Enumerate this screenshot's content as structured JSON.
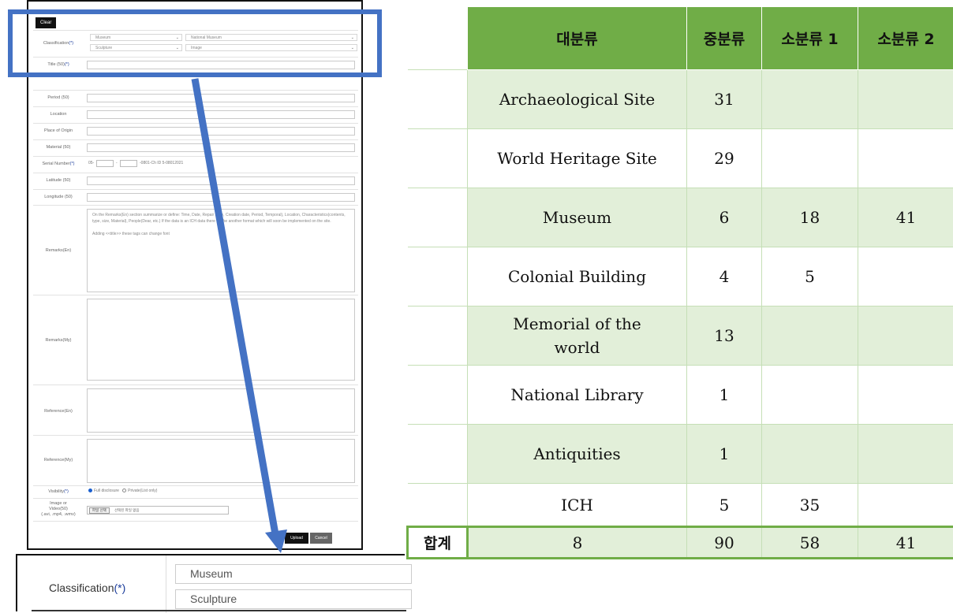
{
  "form": {
    "top_button": "Clear",
    "classification": {
      "label": "Classification",
      "required_mark": "(*)",
      "select1": "Museum",
      "select2": "National Museum",
      "select3": "Sculpture",
      "select4": "Image"
    },
    "title_label": "Title (50)",
    "title_req": "(*)",
    "period_label": "Period (50)",
    "location_label": "Location",
    "place_label": "Place of Origin",
    "material_label": "Material (50)",
    "serial_label": "Serial Number",
    "serial_req": "(*)",
    "serial_prefix": "05-",
    "serial_sep": "-",
    "serial_suffix": "-0801-Ch ID 5-08012021",
    "latitude_label": "Latitude (50)",
    "longitude_label": "Longitude (50)",
    "remarks_en_label": "Remarks(En)",
    "remarks_en_text": "On the Remarks(En) section summarize or define: Time, Date, Repair Date, Creation date, Period, Temporal), Location, Characteristics(contents, type, size, Material), People(Dear, etc.) If the data is an ICH data there will be another format which will soon be implemented on the site.",
    "remarks_en_text2": "Adding <<title>> these tags can change font",
    "remarks_my_label": "Remarks(My)",
    "reference_en_label": "Reference(En)",
    "reference_my_label": "Reference(My)",
    "visibility_label": "Visibility",
    "visibility_req": "(*)",
    "visibility_opt1": "Full disclosure",
    "visibility_opt2": "Private(List only)",
    "media_label1": "Image or",
    "media_label2": "Video(50)",
    "media_label3": "(.avi, .mp4, .wmv)",
    "file_button": "파일 선택",
    "file_text": "선택된 파일 없음",
    "upload_button": "Upload",
    "cancel_button": "Cancel"
  },
  "zoom": {
    "label": "Classification",
    "required_mark": "(*)",
    "select1": "Museum",
    "select2": "Sculpture"
  },
  "table": {
    "headers": [
      "대분류",
      "중분류",
      "소분류 1",
      "소분류 2"
    ],
    "rows": [
      {
        "name": "Archaeological Site",
        "c1": "31",
        "c2": "",
        "c3": ""
      },
      {
        "name": "World Heritage Site",
        "c1": "29",
        "c2": "",
        "c3": ""
      },
      {
        "name": "Museum",
        "c1": "6",
        "c2": "18",
        "c3": "41"
      },
      {
        "name": "Colonial Building",
        "c1": "4",
        "c2": "5",
        "c3": ""
      },
      {
        "name": "Memorial of the world",
        "c1": "13",
        "c2": "",
        "c3": ""
      },
      {
        "name": "National Library",
        "c1": "1",
        "c2": "",
        "c3": ""
      },
      {
        "name": "Antiquities",
        "c1": "1",
        "c2": "",
        "c3": ""
      },
      {
        "name": "ICH",
        "c1": "5",
        "c2": "35",
        "c3": ""
      }
    ],
    "total_label": "합계",
    "total": {
      "name": "8",
      "c1": "90",
      "c2": "58",
      "c3": "41"
    }
  },
  "colors": {
    "header_green": "#70ad47",
    "row_green": "#e2efd9",
    "highlight_blue": "#4472c4"
  }
}
